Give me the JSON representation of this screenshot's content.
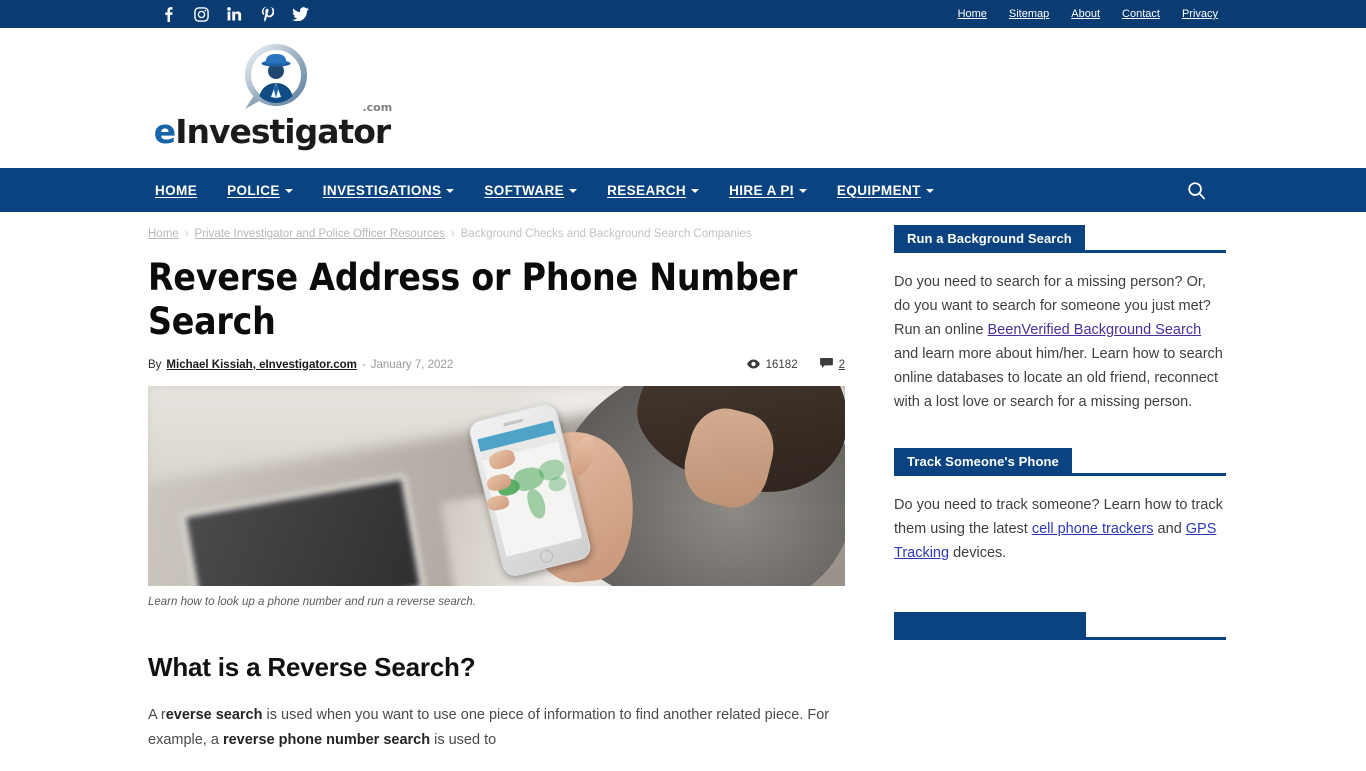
{
  "topbar": {
    "social": [
      {
        "name": "facebook-icon",
        "label": "Facebook"
      },
      {
        "name": "instagram-icon",
        "label": "Instagram"
      },
      {
        "name": "linkedin-icon",
        "label": "LinkedIn"
      },
      {
        "name": "pinterest-icon",
        "label": "Pinterest"
      },
      {
        "name": "twitter-icon",
        "label": "Twitter"
      }
    ],
    "links": [
      "Home",
      "Sitemap",
      "About",
      "Contact",
      "Privacy"
    ]
  },
  "brand": {
    "name_prefix": "e",
    "name_rest": "Investigator",
    "tld": ".com"
  },
  "nav": {
    "items": [
      {
        "label": "HOME",
        "has_dropdown": false
      },
      {
        "label": "POLICE",
        "has_dropdown": true
      },
      {
        "label": "INVESTIGATIONS",
        "has_dropdown": true
      },
      {
        "label": "SOFTWARE",
        "has_dropdown": true
      },
      {
        "label": "RESEARCH",
        "has_dropdown": true
      },
      {
        "label": "HIRE A PI",
        "has_dropdown": true
      },
      {
        "label": "EQUIPMENT",
        "has_dropdown": true
      }
    ],
    "search_icon": "search-icon"
  },
  "breadcrumb": {
    "home": "Home",
    "parent": "Private Investigator and Police Officer Resources",
    "current": "Background Checks and Background Search Companies",
    "separator": "›"
  },
  "article": {
    "title": "Reverse Address or Phone Number Search",
    "by_label": "By",
    "author": "Michael Kissiah, eInvestigator.com",
    "dash": "-",
    "date": "January 7, 2022",
    "views": "16182",
    "comments": "2",
    "image_caption": "Learn how to look up a phone number and run a reverse search.",
    "section_heading": "What is a Reverse Search?",
    "paragraph_1": {
      "part1": "A r",
      "bold1": "everse search",
      "part2": " is used when you want to use one piece of information to find another related piece. For example, a ",
      "bold2": "reverse phone number search",
      "part3": " is used to"
    }
  },
  "sidebar": {
    "widgets": [
      {
        "title": "Run a Background Search",
        "text_1": "Do you need to search for a missing person? Or, do you want to search for someone you just met? Run an online ",
        "link_1": "BeenVerified Background Search",
        "text_2": " and learn more about him/her. Learn how to search online databases to locate an old friend, reconnect with a lost love or search for a missing person."
      },
      {
        "title": "Track Someone's Phone",
        "text_1": "Do you need to track someone? Learn how to track them using the latest ",
        "link_1": "cell phone trackers",
        "text_2": " and ",
        "link_2": "GPS Tracking",
        "text_3": " devices."
      }
    ]
  },
  "colors": {
    "navy": "#0b4380",
    "navy_dark": "#0a3c72",
    "link_blue": "#2b39b8"
  }
}
